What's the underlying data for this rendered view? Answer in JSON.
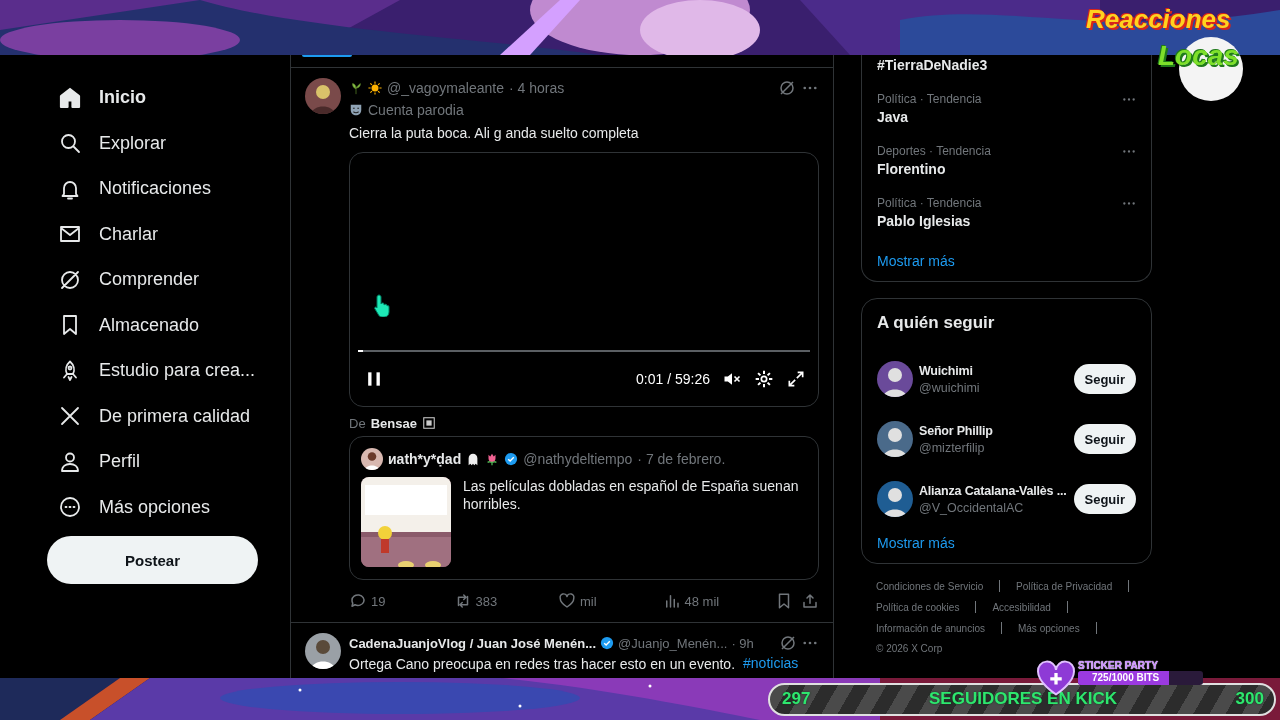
{
  "nav": {
    "items": [
      {
        "label": "Inicio",
        "kind": "home",
        "selected": true
      },
      {
        "label": "Explorar",
        "kind": "search",
        "selected": false
      },
      {
        "label": "Notificaciones",
        "kind": "bell",
        "selected": false
      },
      {
        "label": "Charlar",
        "kind": "mail",
        "selected": false
      },
      {
        "label": "Comprender",
        "kind": "grok",
        "selected": false
      },
      {
        "label": "Almacenado",
        "kind": "bookmark",
        "selected": false
      },
      {
        "label": "Estudio para crea...",
        "kind": "rocket",
        "selected": false
      },
      {
        "label": "De primera calidad",
        "kind": "x",
        "selected": false
      },
      {
        "label": "Perfil",
        "kind": "person",
        "selected": false
      },
      {
        "label": "Más opciones",
        "kind": "more",
        "selected": false
      }
    ],
    "post_button": "Postear"
  },
  "feed": {
    "post": {
      "handle": "@_vagoymaleante",
      "time": "· 4 horas",
      "label": "Cuenta parodia",
      "text": "Cierra la puta boca. Ali g anda suelto completa",
      "video": {
        "playing": true,
        "muted": true,
        "level": 0.01,
        "time": "0:01 / 59:26"
      },
      "source_prefix": "De",
      "source_name": "Bensae",
      "quote": {
        "name": "иath*y*ḍad",
        "verified": true,
        "handle": "@nathydeltiempo",
        "time": "· 7 de febrero.",
        "text": "Las películas dobladas en español de España suenan horribles."
      },
      "actions": [
        {
          "kind": "reply",
          "count": "19"
        },
        {
          "kind": "repost",
          "count": "383"
        },
        {
          "kind": "like",
          "count": "mil"
        },
        {
          "kind": "views",
          "count": "48 mil"
        },
        {
          "kind": "bookmark"
        },
        {
          "kind": "share"
        }
      ]
    },
    "next_post": {
      "name": "CadenaJuanjoVlog / Juan José Menén...",
      "verified": true,
      "handle": "@Juanjo_Menén...",
      "time": "· 9h",
      "text": "Ortega Cano preocupa en redes tras hacer esto en un evento.",
      "hashtag": "#noticias"
    }
  },
  "trends": {
    "first": "#TierraDeNadie3",
    "items": [
      {
        "meta": "Política · Tendencia",
        "name": "Java"
      },
      {
        "meta": "Deportes · Tendencia",
        "name": "Florentino"
      },
      {
        "meta": "Política · Tendencia",
        "name": "Pablo Iglesias"
      }
    ],
    "more": "Mostrar más"
  },
  "follow": {
    "title": "A quién seguir",
    "users": [
      {
        "name": "Wuichimi",
        "handle": "@wuichimi",
        "button": "Seguir"
      },
      {
        "name": "Señor Phillip",
        "handle": "@mizterfilip",
        "button": "Seguir"
      },
      {
        "name": "Alianza Catalana-Vallès ...",
        "handle": "@V_OccidentalAC",
        "button": "Seguir"
      }
    ],
    "more": "Mostrar más"
  },
  "footer": {
    "rows": [
      [
        "Condiciones de Servicio",
        "Política de Privacidad"
      ],
      [
        "Política de cookies",
        "Accesibilidad"
      ],
      [
        "Información de anuncios",
        "Más opciones"
      ]
    ],
    "copyright": "© 2026 X Corp"
  },
  "stream_overlay": {
    "logo": [
      "Reacciones",
      "Locas"
    ],
    "sticker_party": {
      "title": "STICKER PARTY",
      "progress": "725/1000 BITS",
      "level": 0.725
    },
    "goal": {
      "current": "297",
      "label": "SEGUIDORES EN KICK",
      "target": "300"
    }
  }
}
